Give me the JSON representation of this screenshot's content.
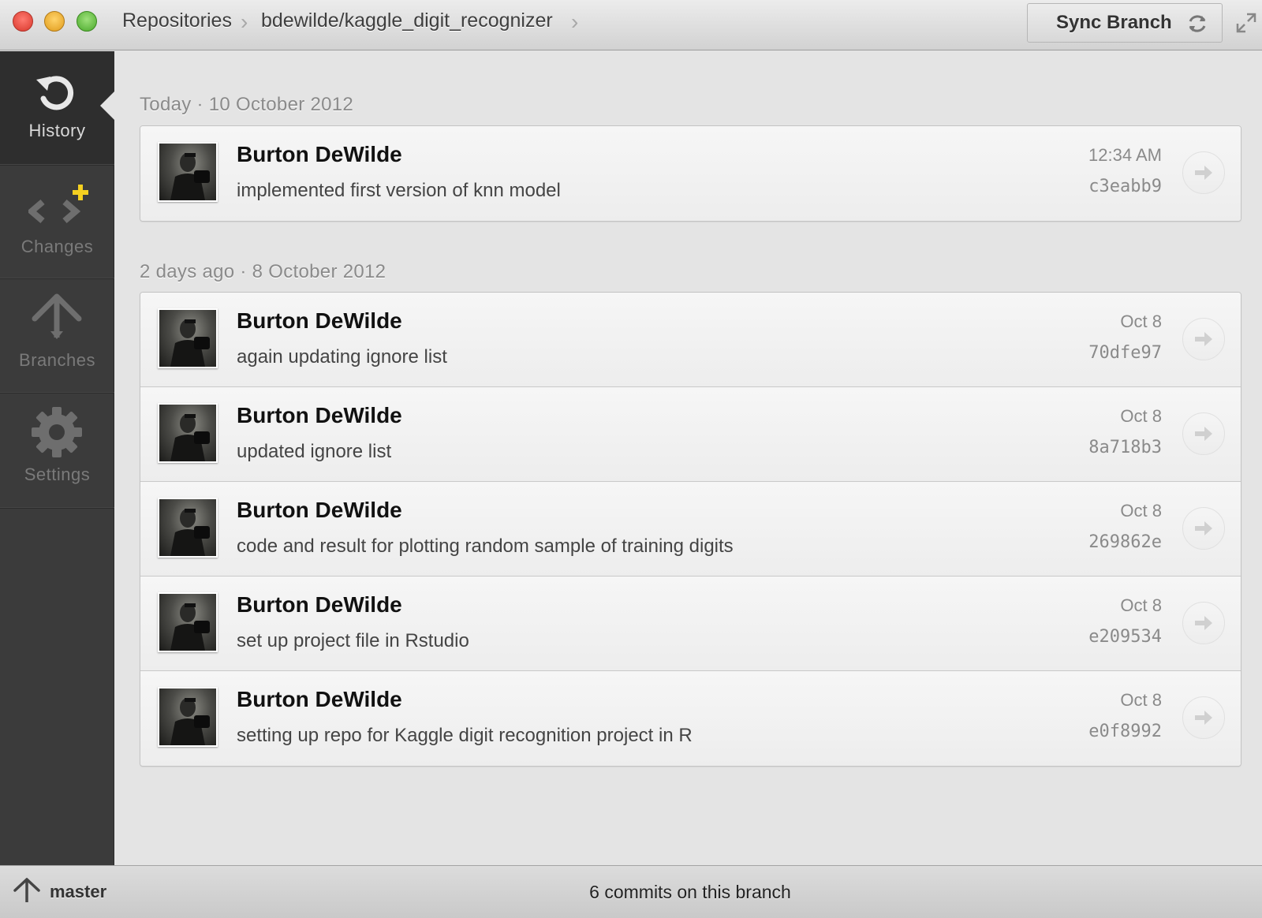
{
  "window": {
    "breadcrumb": [
      "Repositories",
      "bdewilde/kaggle_digit_recognizer"
    ],
    "sync_button": "Sync Branch"
  },
  "sidebar": {
    "items": [
      {
        "label": "History",
        "icon": "history-icon",
        "active": true
      },
      {
        "label": "Changes",
        "icon": "changes-icon",
        "active": false
      },
      {
        "label": "Branches",
        "icon": "branches-icon",
        "active": false
      },
      {
        "label": "Settings",
        "icon": "gear-icon",
        "active": false
      }
    ]
  },
  "groups": [
    {
      "header": "Today · 10 October 2012",
      "commits": [
        {
          "author": "Burton DeWilde",
          "message": "implemented first version of knn model",
          "when": "12:34 AM",
          "sha": "c3eabb9"
        }
      ]
    },
    {
      "header": "2 days ago · 8 October 2012",
      "commits": [
        {
          "author": "Burton DeWilde",
          "message": "again updating ignore list",
          "when": "Oct 8",
          "sha": "70dfe97"
        },
        {
          "author": "Burton DeWilde",
          "message": "updated ignore list",
          "when": "Oct 8",
          "sha": "8a718b3"
        },
        {
          "author": "Burton DeWilde",
          "message": "code and result for plotting random sample of training digits",
          "when": "Oct 8",
          "sha": "269862e"
        },
        {
          "author": "Burton DeWilde",
          "message": "set up project file in Rstudio",
          "when": "Oct 8",
          "sha": "e209534"
        },
        {
          "author": "Burton DeWilde",
          "message": "setting up repo for Kaggle digit recognition project in R",
          "when": "Oct 8",
          "sha": "e0f8992"
        }
      ]
    }
  ],
  "footer": {
    "branch": "master",
    "commit_count": "6 commits on this branch"
  },
  "colors": {
    "sidebar_bg": "#3b3b3b",
    "main_bg": "#e4e4e4",
    "changes_badge": "#f5d020"
  }
}
